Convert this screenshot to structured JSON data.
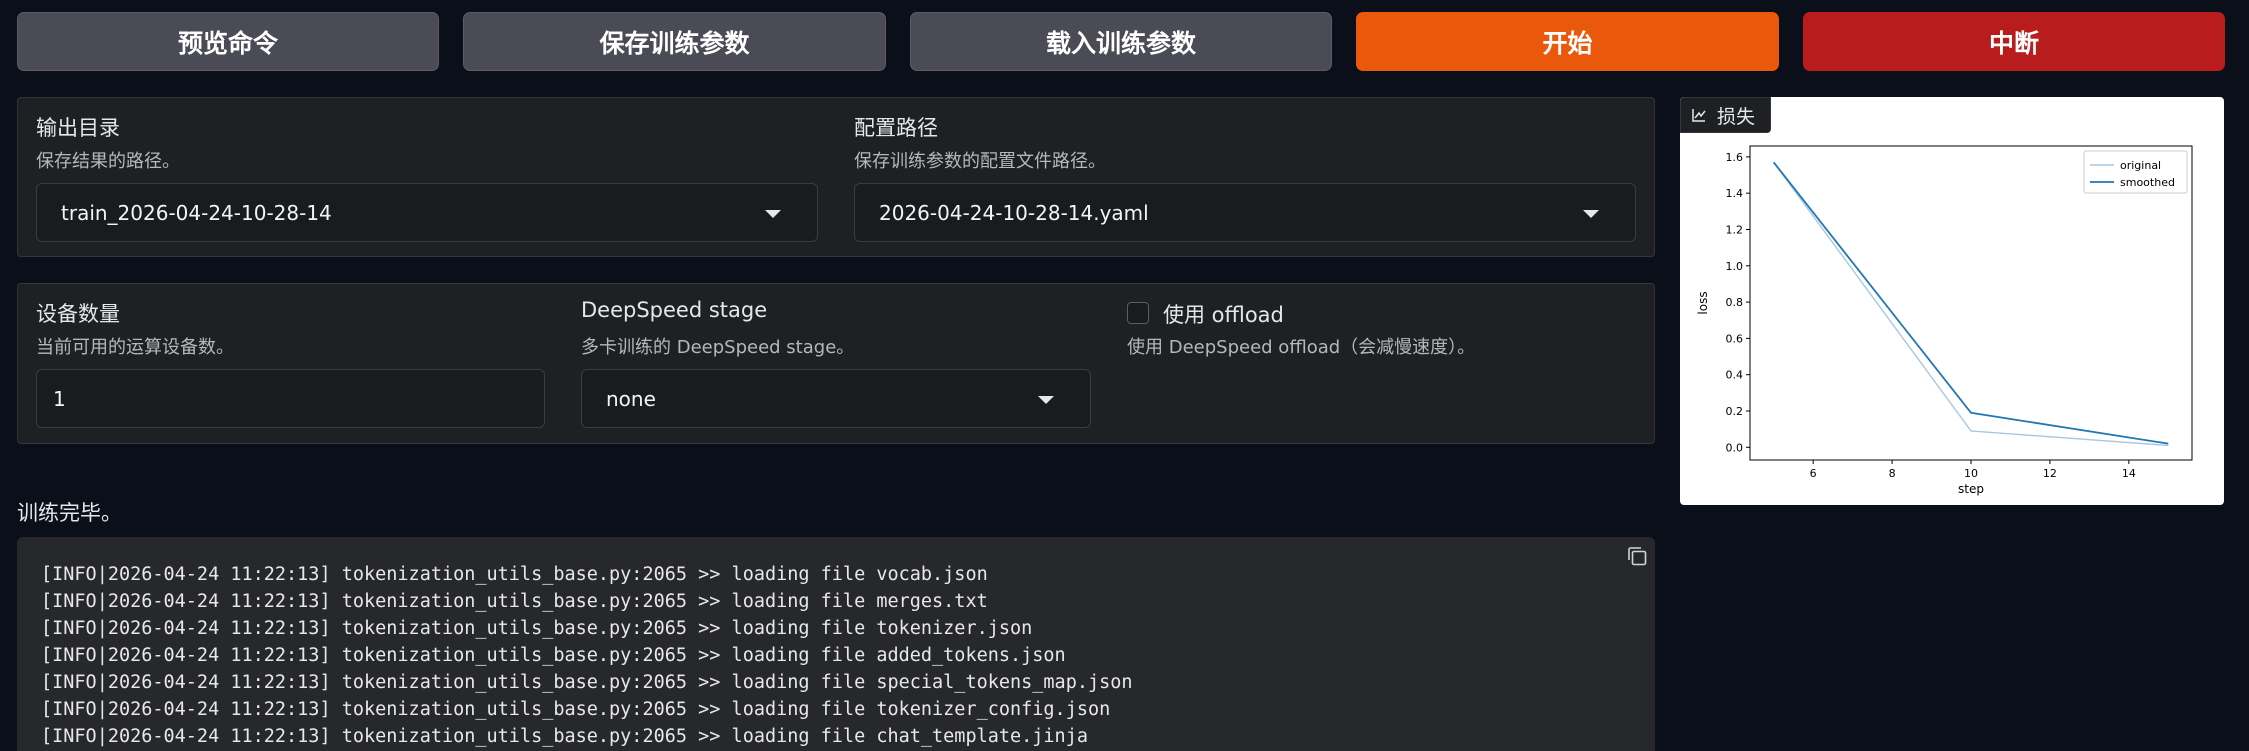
{
  "buttons": {
    "preview": "预览命令",
    "save_args": "保存训练参数",
    "load_args": "载入训练参数",
    "start": "开始",
    "abort": "中断"
  },
  "output_dir": {
    "label": "输出目录",
    "info": "保存结果的路径。",
    "value": "train_2026-04-24-10-28-14"
  },
  "config_path": {
    "label": "配置路径",
    "info": "保存训练参数的配置文件路径。",
    "value": "2026-04-24-10-28-14.yaml"
  },
  "device_count": {
    "label": "设备数量",
    "info": "当前可用的运算设备数。",
    "value": "1"
  },
  "ds_stage": {
    "label": "DeepSpeed stage",
    "info": "多卡训练的 DeepSpeed stage。",
    "value": "none"
  },
  "ds_offload": {
    "label": "使用 offload",
    "info": "使用 DeepSpeed offload（会减慢速度）。",
    "checked": false
  },
  "loss_plot": {
    "tab_label": "损失",
    "icon": "chart-icon"
  },
  "chart_data": {
    "type": "line",
    "title": "",
    "xlabel": "step",
    "ylabel": "loss",
    "xlim": [
      4.4,
      15.6
    ],
    "ylim": [
      -0.07,
      1.66
    ],
    "xticks": [
      6,
      8,
      10,
      12,
      14
    ],
    "yticks": [
      0.0,
      0.2,
      0.4,
      0.6,
      0.8,
      1.0,
      1.2,
      1.4,
      1.6
    ],
    "legend_position": "top-right",
    "grid": false,
    "series": [
      {
        "name": "original",
        "color": "#a6c9e2",
        "x": [
          5,
          10,
          15
        ],
        "y": [
          1.57,
          0.09,
          0.01
        ]
      },
      {
        "name": "smoothed",
        "color": "#1f77b4",
        "x": [
          5,
          10,
          15
        ],
        "y": [
          1.57,
          0.19,
          0.02
        ]
      }
    ]
  },
  "status": "训练完毕。",
  "log": {
    "copy_icon": "copy-icon",
    "lines": [
      "[INFO|2026-04-24 11:22:13] tokenization_utils_base.py:2065 >> loading file vocab.json",
      "[INFO|2026-04-24 11:22:13] tokenization_utils_base.py:2065 >> loading file merges.txt",
      "[INFO|2026-04-24 11:22:13] tokenization_utils_base.py:2065 >> loading file tokenizer.json",
      "[INFO|2026-04-24 11:22:13] tokenization_utils_base.py:2065 >> loading file added_tokens.json",
      "[INFO|2026-04-24 11:22:13] tokenization_utils_base.py:2065 >> loading file special_tokens_map.json",
      "[INFO|2026-04-24 11:22:13] tokenization_utils_base.py:2065 >> loading file tokenizer_config.json",
      "[INFO|2026-04-24 11:22:13] tokenization_utils_base.py:2065 >> loading file chat_template.jinja"
    ]
  },
  "colors": {
    "primary": "#ea580c",
    "stop": "#b91c1c",
    "background": "#0b0f19"
  }
}
